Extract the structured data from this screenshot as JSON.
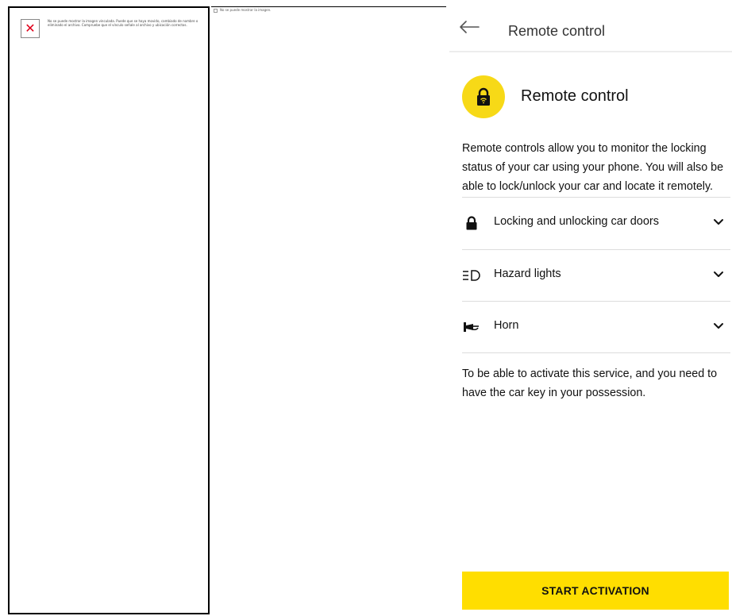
{
  "left_panel": {
    "broken_image_message": "No se puede mostrar la imagen vinculada. Puede que se haya movido, cambiado de nombre o eliminado el archivo. Compruebe que el vínculo señale al archivo y ubicación correctos."
  },
  "middle_panel": {
    "broken_image_message": "No se puede mostrar la imagen."
  },
  "header": {
    "back_icon": "arrow-left-icon",
    "title": "Remote control"
  },
  "hero": {
    "icon": "lock-wifi-icon",
    "title": "Remote control",
    "badge_color": "#f7d917"
  },
  "description": "Remote controls allow you to monitor the locking status of your car using your phone. You will also be able to lock/unlock your car and locate it remotely.",
  "features": [
    {
      "icon": "lock-icon",
      "label": "Locking and unlocking car doors"
    },
    {
      "icon": "hazard-lights-icon",
      "label": "Hazard lights"
    },
    {
      "icon": "horn-icon",
      "label": "Horn"
    }
  ],
  "note": "To be able to  activate this service, and you need to have the car key in your possession.",
  "cta": {
    "label": "START ACTIVATION",
    "color": "#ffde00"
  }
}
